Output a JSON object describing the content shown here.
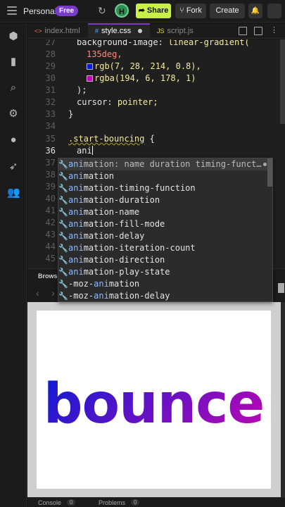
{
  "topbar": {
    "workspace": "Personal",
    "plan_badge": "Free",
    "avatar_letter": "H",
    "share_label": "Share",
    "fork_label": "Fork",
    "create_label": "Create"
  },
  "tabs": [
    {
      "label": "index.html",
      "icon": "<>"
    },
    {
      "label": "style.css",
      "icon": "#"
    },
    {
      "label": "script.js",
      "icon": "JS"
    }
  ],
  "editor": {
    "line_numbers": [
      "27",
      "28",
      "29",
      "30",
      "31",
      "32",
      "33",
      "34",
      "35",
      "36",
      "37",
      "38",
      "39",
      "40",
      "41",
      "42",
      "43",
      "44",
      "45"
    ],
    "current_line": "36",
    "lines": {
      "l27_prop": "background-image:",
      "l27_val": "linear-gradient(",
      "l28": "135deg,",
      "l29": "rgb(7, 28, 214, 0.8),",
      "l30": "rgba(194, 6, 178, 1)",
      "l31": ");",
      "l32_prop": "cursor:",
      "l32_val": "pointer;",
      "l33": "}",
      "l35_selector": ".start-bouncing",
      "l35_brace": "{",
      "l36": "ani"
    },
    "swatch_colors": {
      "rgb": "#071cd6",
      "rgba": "#c206b2"
    }
  },
  "autocomplete": {
    "typed": "ani",
    "items": [
      {
        "prefix": "ani",
        "rest": "mation: name duration timing-funct…"
      },
      {
        "prefix": "ani",
        "rest": "mation"
      },
      {
        "prefix": "ani",
        "rest": "mation-timing-function"
      },
      {
        "prefix": "ani",
        "rest": "mation-duration"
      },
      {
        "prefix": "ani",
        "rest": "mation-name"
      },
      {
        "prefix": "ani",
        "rest": "mation-fill-mode"
      },
      {
        "prefix": "ani",
        "rest": "mation-delay"
      },
      {
        "prefix": "ani",
        "rest": "mation-iteration-count"
      },
      {
        "prefix": "ani",
        "rest": "mation-direction"
      },
      {
        "prefix": "ani",
        "rest": "mation-play-state"
      },
      {
        "pre": "-moz-",
        "prefix": "ani",
        "rest": "mation"
      },
      {
        "pre": "-moz-",
        "prefix": "ani",
        "rest": "mation-delay"
      }
    ]
  },
  "browser": {
    "label": "Browse",
    "preview_text": "bounce",
    "gradient": {
      "from": "#071cd6",
      "to": "#c206b2"
    }
  },
  "statusbar": {
    "console_label": "Console",
    "console_count": "0",
    "problems_label": "Problems",
    "problems_count": "0"
  }
}
